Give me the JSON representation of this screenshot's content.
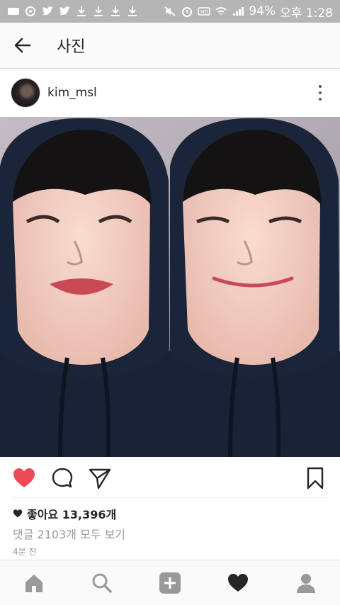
{
  "status_bar": {
    "battery": "94%",
    "time": "오후 1:28"
  },
  "app_bar": {
    "title": "사진"
  },
  "post": {
    "username": "kim_msl",
    "likes": "좋아요 13,396개",
    "comments_link": "댓글 2103개 모두 보기",
    "time_ago": "4분 전"
  },
  "icons": {
    "back": "back-arrow-icon",
    "more": "more-vertical-icon",
    "like": "heart-icon",
    "comment": "comment-icon",
    "share": "send-icon",
    "save": "bookmark-icon",
    "nav": [
      "home-icon",
      "search-icon",
      "add-icon",
      "activity-heart-icon",
      "profile-icon"
    ]
  },
  "colors": {
    "like_red": "#ed4956",
    "statusbar_bg": "#b5b5b5",
    "navbar_bg": "#fafafa"
  }
}
